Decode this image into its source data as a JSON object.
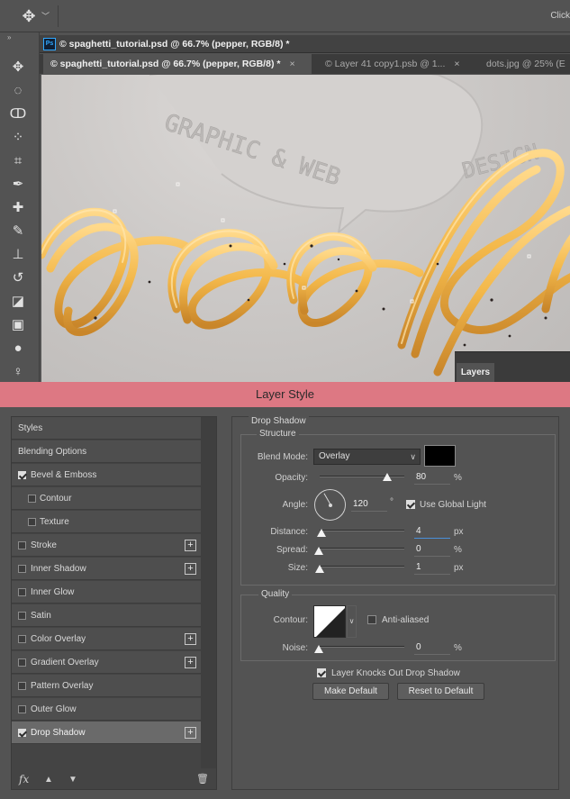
{
  "options_bar": {
    "tool_icon": "move-tool-icon",
    "dropdown_icon": "chevron-down-icon",
    "right_text": "Click"
  },
  "toolbar": {
    "collapse_glyph": "»",
    "tools": [
      {
        "name": "move-tool-icon",
        "glyph": "✥"
      },
      {
        "name": "marquee-tool-icon",
        "glyph": "◌"
      },
      {
        "name": "lasso-tool-icon",
        "glyph": "ↀ"
      },
      {
        "name": "quick-select-tool-icon",
        "glyph": "⁘"
      },
      {
        "name": "crop-tool-icon",
        "glyph": "⌗"
      },
      {
        "name": "eyedropper-tool-icon",
        "glyph": "✒"
      },
      {
        "name": "healing-brush-tool-icon",
        "glyph": "✚"
      },
      {
        "name": "brush-tool-icon",
        "glyph": "✎"
      },
      {
        "name": "stamp-tool-icon",
        "glyph": "⊥"
      },
      {
        "name": "history-brush-tool-icon",
        "glyph": "↺"
      },
      {
        "name": "eraser-tool-icon",
        "glyph": "◪"
      },
      {
        "name": "gradient-tool-icon",
        "glyph": "▣"
      },
      {
        "name": "blur-tool-icon",
        "glyph": "●"
      },
      {
        "name": "dodge-tool-icon",
        "glyph": "♀"
      }
    ]
  },
  "document": {
    "ps_logo": "Ps",
    "title": "© spaghetti_tutorial.psd @ 66.7% (pepper, RGB/8) *",
    "tabs": [
      {
        "label": "© spaghetti_tutorial.psd @ 66.7% (pepper, RGB/8) *",
        "close": "×",
        "active": true
      },
      {
        "label": "© Layer 41 copy1.psb @ 1...",
        "close": "×",
        "active": false
      },
      {
        "label": "dots.jpg @ 25% (E",
        "close": "",
        "active": false
      }
    ]
  },
  "canvas": {
    "embossed_text_1": "GRAPHIC & WEB",
    "embossed_text_2": "DESIGN",
    "colors": {
      "pasta": "#f3b84a",
      "pasta_dark": "#c9862a",
      "background": "#cbc8c6"
    }
  },
  "layers_panel": {
    "tab_label": "Layers"
  },
  "dialog": {
    "title": "Layer Style",
    "title_bar_color": "#dd7883",
    "styles_list": [
      {
        "label": "Styles",
        "type": "header"
      },
      {
        "label": "Blending Options",
        "type": "header"
      },
      {
        "label": "Bevel & Emboss",
        "type": "check",
        "checked": true,
        "plus": false
      },
      {
        "label": "Contour",
        "type": "sub",
        "checked": false,
        "plus": false
      },
      {
        "label": "Texture",
        "type": "sub",
        "checked": false,
        "plus": false
      },
      {
        "label": "Stroke",
        "type": "check",
        "checked": false,
        "plus": true
      },
      {
        "label": "Inner Shadow",
        "type": "check",
        "checked": false,
        "plus": true
      },
      {
        "label": "Inner Glow",
        "type": "check",
        "checked": false,
        "plus": false
      },
      {
        "label": "Satin",
        "type": "check",
        "checked": false,
        "plus": false
      },
      {
        "label": "Color Overlay",
        "type": "check",
        "checked": false,
        "plus": true
      },
      {
        "label": "Gradient Overlay",
        "type": "check",
        "checked": false,
        "plus": true
      },
      {
        "label": "Pattern Overlay",
        "type": "check",
        "checked": false,
        "plus": false
      },
      {
        "label": "Outer Glow",
        "type": "check",
        "checked": false,
        "plus": false
      },
      {
        "label": "Drop Shadow",
        "type": "check",
        "checked": true,
        "plus": true,
        "selected": true
      }
    ],
    "footer_icons": {
      "fx": "fx",
      "up": "▲",
      "down": "▼",
      "trash": "🗑"
    },
    "drop_shadow": {
      "section_title": "Drop Shadow",
      "structure_title": "Structure",
      "blend_mode_label": "Blend Mode:",
      "blend_mode_value": "Overlay",
      "shadow_color": "#000000",
      "opacity_label": "Opacity:",
      "opacity_value": "80",
      "opacity_fraction": 0.8,
      "angle_label": "Angle:",
      "angle_value": "120",
      "degree_symbol": "°",
      "use_global_light_label": "Use Global Light",
      "use_global_light_checked": true,
      "distance_label": "Distance:",
      "distance_value": "4",
      "spread_label": "Spread:",
      "spread_value": "0",
      "size_label": "Size:",
      "size_value": "1",
      "unit_px": "px",
      "unit_pct": "%",
      "quality_title": "Quality",
      "contour_label": "Contour:",
      "anti_aliased_label": "Anti-aliased",
      "anti_aliased_checked": false,
      "noise_label": "Noise:",
      "noise_value": "0",
      "knockout_label": "Layer Knocks Out Drop Shadow",
      "knockout_checked": true,
      "make_default_label": "Make Default",
      "reset_default_label": "Reset to Default"
    }
  }
}
